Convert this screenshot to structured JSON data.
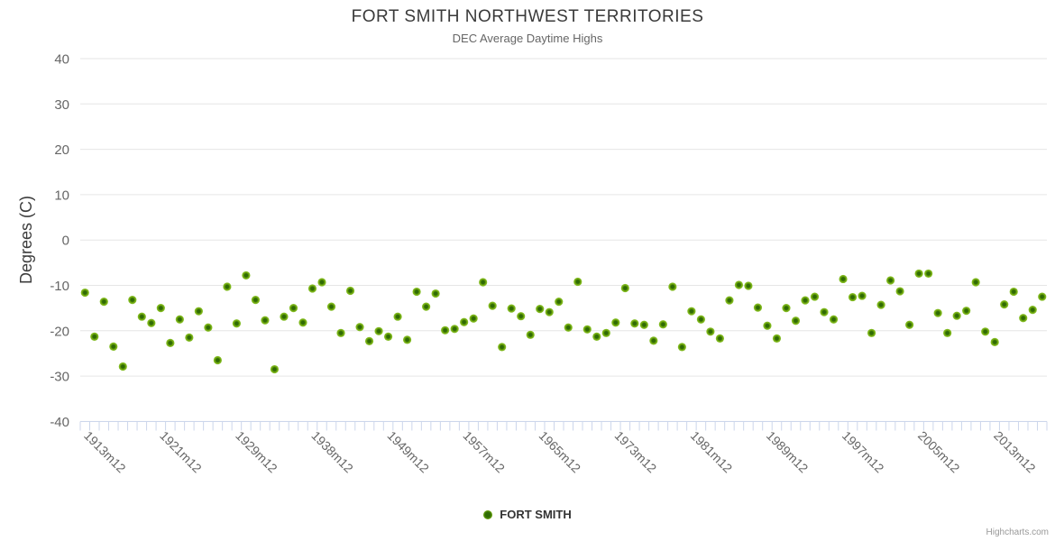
{
  "colors": {
    "marker_center": "#2f6b04",
    "marker_mid": "#76ad10",
    "marker_edge": "#8ac432",
    "grid": "#e6e6e6",
    "axis_line": "#ccd6eb",
    "tick": "#ccd6eb",
    "axis_label": "#666666",
    "title_text": "#3a3a3a",
    "subtitle_text": "#666666",
    "credits_text": "#999999"
  },
  "legend": {
    "label": "FORT SMITH"
  },
  "credits": "Highcharts.com",
  "chart_data": {
    "type": "scatter",
    "title": "FORT SMITH NORTHWEST TERRITORIES",
    "subtitle": "DEC Average Daytime Highs",
    "ylabel": "Degrees (C)",
    "ylim": [
      -40,
      40
    ],
    "y_ticks": [
      40,
      30,
      20,
      10,
      0,
      -10,
      -20,
      -30,
      -40
    ],
    "grid": true,
    "legend_position": "bottom",
    "x_tick_labels": [
      "1913m12",
      "1921m12",
      "1929m12",
      "1938m12",
      "1949m12",
      "1957m12",
      "1965m12",
      "1973m12",
      "1981m12",
      "1989m12",
      "1997m12",
      "2005m12",
      "2013m12"
    ],
    "x_tick_label_indices": [
      0,
      8,
      16,
      24,
      32,
      40,
      48,
      56,
      64,
      72,
      80,
      88,
      96
    ],
    "series": [
      {
        "name": "FORT SMITH",
        "values": [
          -11.6,
          -21.3,
          -13.6,
          -23.5,
          -27.9,
          -13.2,
          -16.9,
          -18.3,
          -15.0,
          -22.7,
          -17.5,
          -21.5,
          -15.7,
          -19.3,
          -26.5,
          -10.3,
          -18.4,
          -7.8,
          -13.2,
          -17.7,
          -28.5,
          -16.9,
          -15.0,
          -18.2,
          -10.7,
          -9.3,
          -14.7,
          -20.5,
          -11.2,
          -19.2,
          -22.3,
          -20.1,
          -21.3,
          -16.9,
          -22.0,
          -11.4,
          -14.7,
          -11.8,
          -19.9,
          -19.6,
          -18.1,
          -17.3,
          -9.3,
          -14.5,
          -23.6,
          -15.1,
          -16.8,
          -20.9,
          -15.2,
          -15.9,
          -13.6,
          -19.3,
          -9.2,
          -19.7,
          -21.3,
          -20.5,
          -18.2,
          -10.6,
          -18.4,
          -18.7,
          -22.2,
          -18.6,
          -10.3,
          -23.6,
          -15.7,
          -17.5,
          -20.2,
          -21.7,
          -13.3,
          -9.9,
          -10.1,
          -14.9,
          -18.9,
          -21.7,
          -15.0,
          -17.8,
          -13.3,
          -12.5,
          -15.9,
          -17.5,
          -8.6,
          -12.6,
          -12.3,
          -20.5,
          -14.3,
          -8.9,
          -11.3,
          -18.7,
          -7.4,
          -7.4,
          -16.1,
          -20.5,
          -16.7,
          -15.6,
          -9.3,
          -20.2,
          -22.5,
          -14.2,
          -11.4,
          -17.2,
          -15.4,
          -12.5
        ]
      }
    ]
  }
}
